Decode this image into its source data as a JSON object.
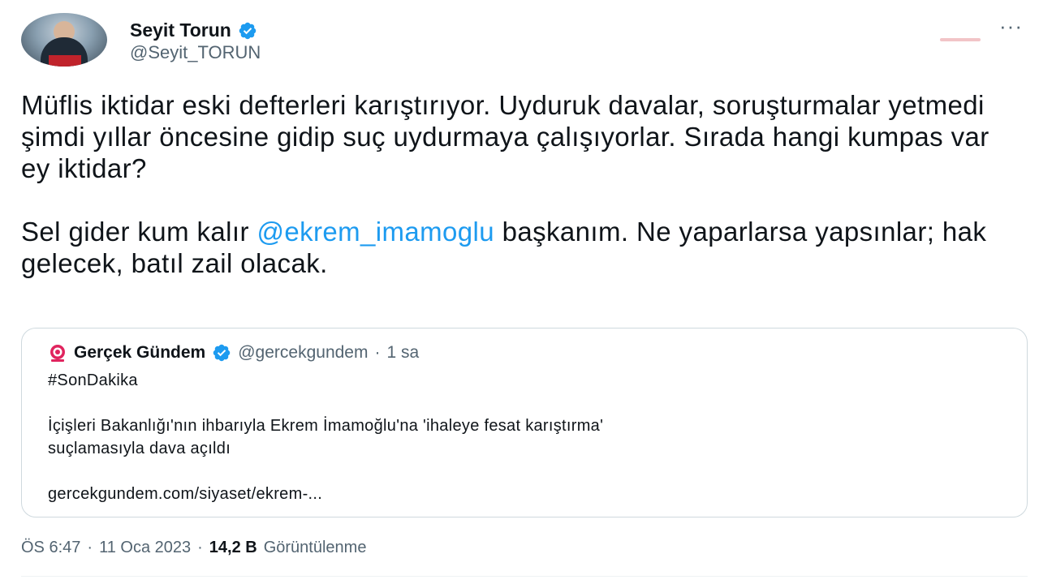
{
  "author": {
    "display_name": "Seyit Torun",
    "handle": "@Seyit_TORUN",
    "verified": true
  },
  "tweet": {
    "paragraph1": "Müflis iktidar eski defterleri karıştırıyor. Uyduruk davalar, soruşturmalar yetmedi şimdi yıllar öncesine gidip suç uydurmaya çalışıyorlar. Sırada hangi kumpas var ey iktidar?",
    "paragraph2_before": "Sel gider kum kalır ",
    "paragraph2_mention": "@ekrem_imamoglu",
    "paragraph2_after": " başkanım. Ne yaparlarsa yapsınlar; hak gelecek, batıl zail olacak."
  },
  "quoted": {
    "name": "Gerçek Gündem",
    "handle": "@gercekgundem",
    "separator": "·",
    "time": "1 sa",
    "hashtag": "#SonDakika",
    "text_line1": "İçişleri Bakanlığı'nın ihbarıyla Ekrem İmamoğlu'na 'ihaleye fesat karıştırma'",
    "text_line2": "suçlamasıyla dava açıldı",
    "link": "gercekgundem.com/siyaset/ekrem-..."
  },
  "meta": {
    "time": "ÖS 6:47",
    "sep1": "·",
    "date": "11 Oca 2023",
    "sep2": "·",
    "views_count": "14,2 B",
    "views_label": "Görüntülenme"
  },
  "icons": {
    "verified": "verified-badge-icon",
    "more": "more-options-icon",
    "quoted_logo": "gercek-gundem-logo-icon"
  },
  "colors": {
    "accent": "#1d9bf0",
    "text": "#0f1419",
    "secondary": "#536471",
    "border": "#cfd9de",
    "logo_red": "#e0245e"
  }
}
